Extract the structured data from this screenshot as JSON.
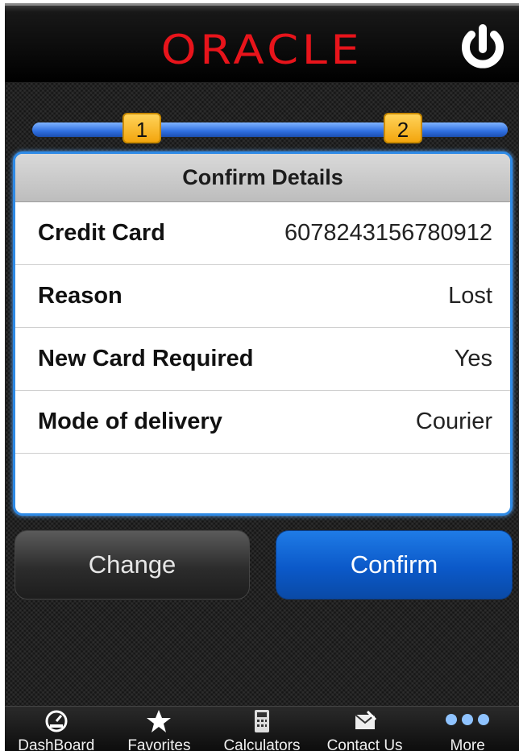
{
  "app": {
    "logo_text": "ORACLE",
    "brand_color": "#e8141b"
  },
  "header": {
    "power_icon": "power-icon"
  },
  "stepper": {
    "steps": [
      "1",
      "2"
    ],
    "accent_color": "#f3a60e"
  },
  "confirm": {
    "title": "Confirm Details",
    "rows": [
      {
        "label": "Credit Card",
        "value": "6078243156780912"
      },
      {
        "label": "Reason",
        "value": "Lost"
      },
      {
        "label": "New Card Required",
        "value": "Yes"
      },
      {
        "label": "Mode of delivery",
        "value": "Courier"
      }
    ]
  },
  "actions": {
    "change_label": "Change",
    "confirm_label": "Confirm"
  },
  "tabbar": {
    "items": [
      {
        "label": "DashBoard",
        "icon": "dashboard-icon"
      },
      {
        "label": "Favorites",
        "icon": "star-icon"
      },
      {
        "label": "Calculators",
        "icon": "calculator-icon"
      },
      {
        "label": "Contact Us",
        "icon": "mail-icon"
      },
      {
        "label": "More",
        "icon": "more-icon"
      }
    ]
  }
}
